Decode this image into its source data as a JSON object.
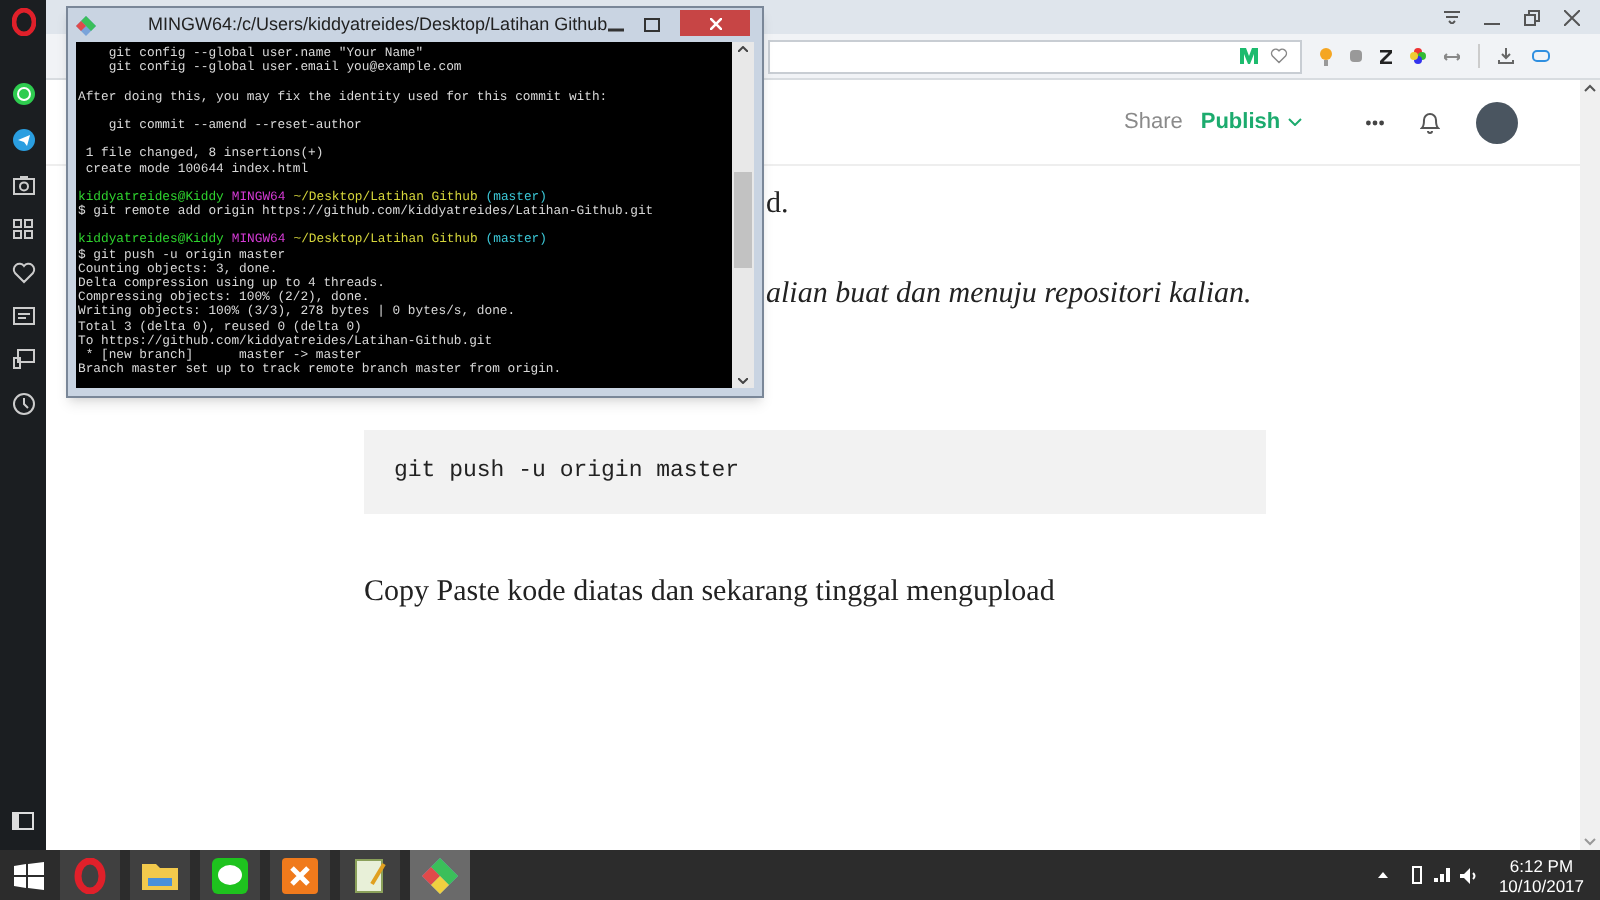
{
  "terminal": {
    "title": "MINGW64:/c/Users/kiddyatreides/Desktop/Latihan Github",
    "lines": [
      {
        "kind": "text",
        "space_before": false,
        "text": "    git config --global user.name \"Your Name\""
      },
      {
        "kind": "text",
        "space_before": false,
        "text": "    git config --global user.email you@example.com"
      },
      {
        "kind": "text",
        "space_before": true,
        "text": "After doing this, you may fix the identity used for this commit with:"
      },
      {
        "kind": "text",
        "space_before": true,
        "text": "    git commit --amend --reset-author"
      },
      {
        "kind": "text",
        "space_before": true,
        "text": " 1 file changed, 8 insertions(+)"
      },
      {
        "kind": "text",
        "space_before": false,
        "text": " create mode 100644 index.html"
      },
      {
        "kind": "prompt",
        "space_before": true,
        "user": "kiddyatreides@Kiddy",
        "host": "MINGW64",
        "path": "~/Desktop/Latihan Github",
        "branch": "(master)"
      },
      {
        "kind": "text",
        "space_before": false,
        "text": "$ git remote add origin https://github.com/kiddyatreides/Latihan-Github.git"
      },
      {
        "kind": "prompt",
        "space_before": true,
        "user": "kiddyatreides@Kiddy",
        "host": "MINGW64",
        "path": "~/Desktop/Latihan Github",
        "branch": "(master)"
      },
      {
        "kind": "text",
        "space_before": false,
        "text": "$ git push -u origin master"
      },
      {
        "kind": "text",
        "space_before": false,
        "text": "Counting objects: 3, done."
      },
      {
        "kind": "text",
        "space_before": false,
        "text": "Delta compression using up to 4 threads."
      },
      {
        "kind": "text",
        "space_before": false,
        "text": "Compressing objects: 100% (2/2), done."
      },
      {
        "kind": "text",
        "space_before": false,
        "text": "Writing objects: 100% (3/3), 278 bytes | 0 bytes/s, done."
      },
      {
        "kind": "text",
        "space_before": false,
        "text": "Total 3 (delta 0), reused 0 (delta 0)"
      },
      {
        "kind": "text",
        "space_before": false,
        "text": "To https://github.com/kiddyatreides/Latihan-Github.git"
      },
      {
        "kind": "text",
        "space_before": false,
        "text": " * [new branch]      master -> master"
      },
      {
        "kind": "text",
        "space_before": false,
        "text": "Branch master set up to track remote branch master from origin."
      }
    ]
  },
  "article_header": {
    "share": "Share",
    "publish": "Publish"
  },
  "article": {
    "paragraphs": [
      {
        "kind": "text",
        "text": "d."
      },
      {
        "kind": "italic",
        "text": "alian buat dan menuju repositori kalian."
      },
      {
        "kind": "code",
        "text": "git push -u origin master"
      },
      {
        "kind": "text",
        "text": "Copy Paste kode diatas dan sekarang tinggal mengupload"
      }
    ]
  },
  "taskbar": {
    "apps": [
      {
        "selected": false
      },
      {
        "selected": false
      },
      {
        "selected": false
      },
      {
        "selected": false
      },
      {
        "selected": false
      },
      {
        "selected": true
      }
    ]
  },
  "clock": {
    "time": "6:12 PM",
    "date": "10/10/2017"
  }
}
